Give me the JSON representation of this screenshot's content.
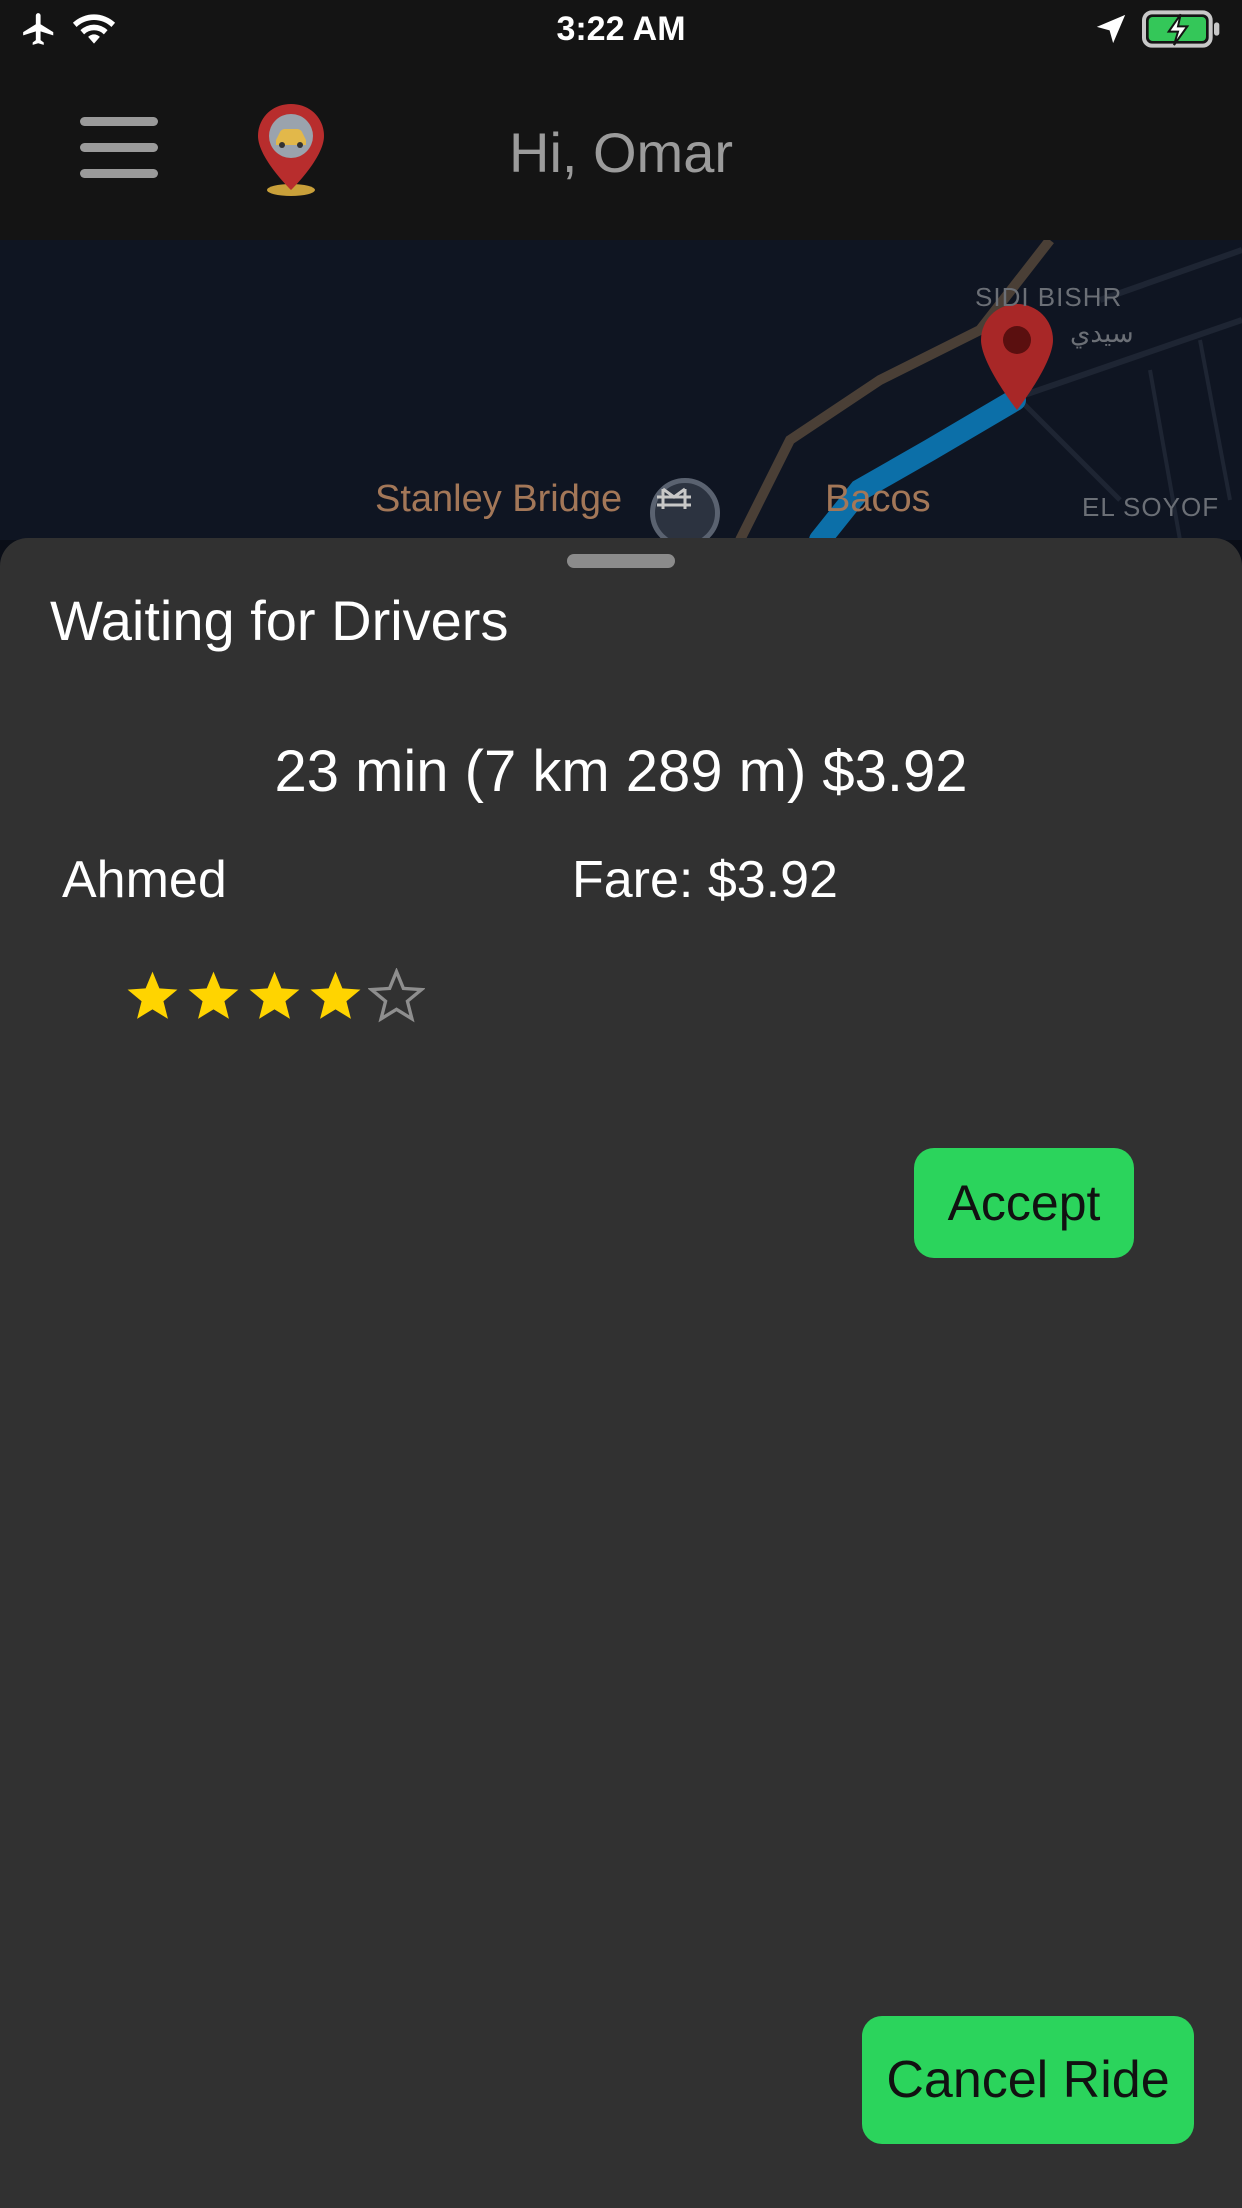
{
  "status_bar": {
    "time": "3:22 AM",
    "icons": [
      "airplane-icon",
      "wifi-icon",
      "location-arrow-icon",
      "battery-charging-icon"
    ]
  },
  "header": {
    "menu_icon": "hamburger-menu-icon",
    "logo_icon": "car-pin-logo",
    "greeting": "Hi, Omar"
  },
  "map": {
    "labels": {
      "sidi_bishr": "SIDI BISHR",
      "sidi_bishr_ar": "سيدي",
      "stanley_bridge": "Stanley Bridge",
      "bacos": "Bacos",
      "el_soyof": "EL SOYOF"
    },
    "colors": {
      "route": "#0c6fa8",
      "pin": "#b22a2a",
      "road": "#4a3f36"
    }
  },
  "sheet": {
    "title": "Waiting for Drivers",
    "route_summary": "23 min (7 km 289 m) $3.92",
    "offer": {
      "driver_name": "Ahmed",
      "fare": "Fare: $3.92",
      "rating": 4,
      "rating_max": 5,
      "accept_label": "Accept"
    },
    "cancel_label": "Cancel Ride"
  },
  "colors": {
    "accent_green": "#2bd45c",
    "star_filled": "#ffd400",
    "sheet_bg": "#313131",
    "header_bg": "#141414"
  }
}
